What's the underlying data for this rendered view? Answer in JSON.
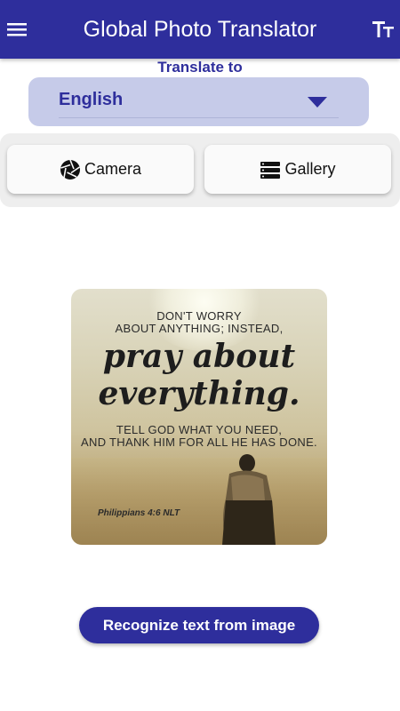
{
  "app": {
    "title": "Global Photo Translator",
    "accent_color": "#2e2e9c",
    "menu_icon": "hamburger-menu-icon",
    "text_size_icon": "text-size-icon"
  },
  "translate": {
    "label": "Translate to",
    "selected_language": "English"
  },
  "source": {
    "camera_label": "Camera",
    "camera_icon": "camera-shutter-icon",
    "gallery_label": "Gallery",
    "gallery_icon": "gallery-list-icon"
  },
  "image": {
    "line1": "DON'T WORRY",
    "line2": "ABOUT ANYTHING; INSTEAD,",
    "line3": "pray about",
    "line4": "everything.",
    "line5": "TELL GOD WHAT YOU NEED,",
    "line6": "AND THANK HIM FOR ALL HE HAS DONE.",
    "reference": "Philippians 4:6 NLT"
  },
  "actions": {
    "recognize_label": "Recognize text from image"
  }
}
